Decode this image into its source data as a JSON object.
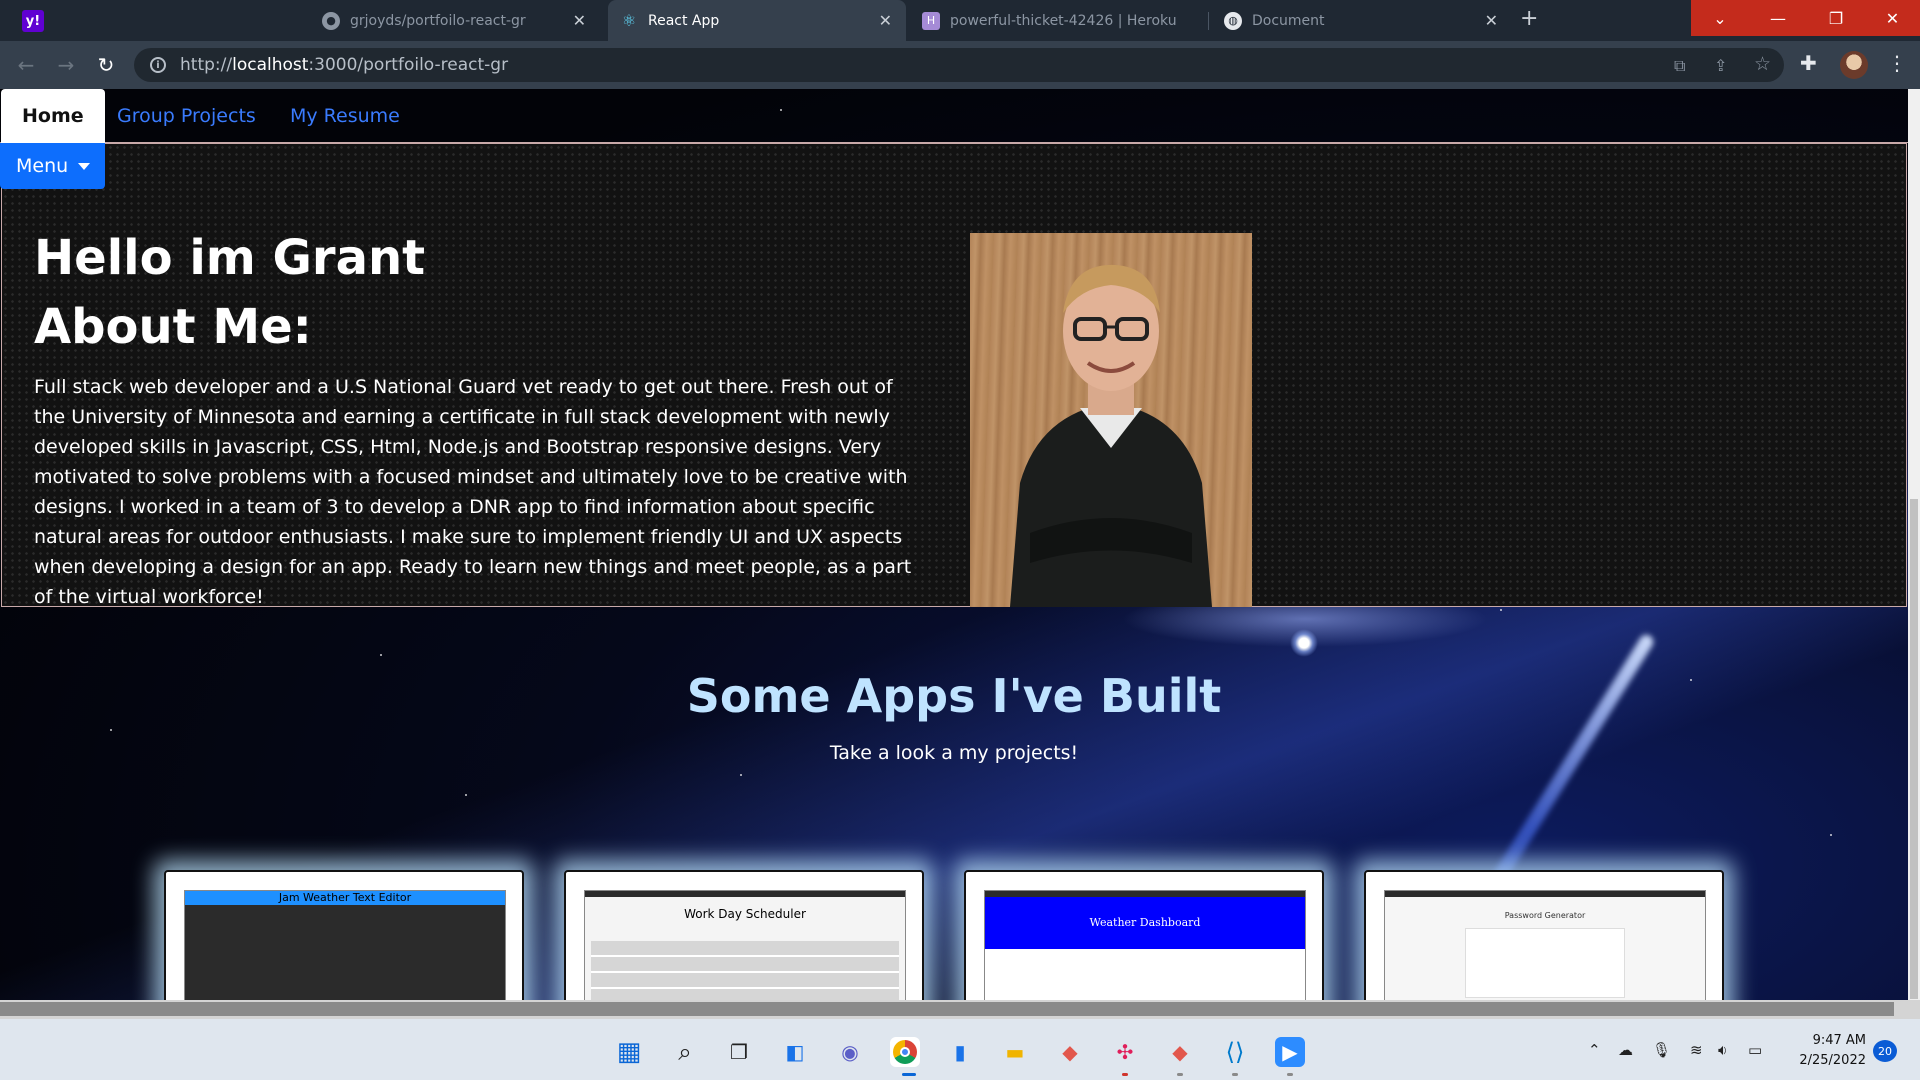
{
  "browser": {
    "tabs": [
      {
        "label": "grjoyds/portfoilo-react-gr",
        "icon": "github-icon",
        "active": false
      },
      {
        "label": "React App",
        "icon": "react-icon",
        "active": true
      },
      {
        "label": "powerful-thicket-42426 | Heroku",
        "icon": "heroku-icon",
        "active": false
      },
      {
        "label": "Document",
        "icon": "globe-icon",
        "active": false
      }
    ],
    "url_prefix": "http://",
    "url_host": "localhost",
    "url_rest": ":3000/portfoilo-react-gr"
  },
  "nav": {
    "tabs": [
      {
        "label": "Home",
        "active": true
      },
      {
        "label": "Group Projects",
        "active": false
      },
      {
        "label": "My Resume",
        "active": false
      }
    ],
    "menu_label": "Menu"
  },
  "about": {
    "hello": "Hello im Grant",
    "heading": "About Me:",
    "bio": "Full stack web developer and a U.S National Guard vet ready to get out there. Fresh out of the University of Minnesota and earning a certificate in full stack development with newly developed skills in Javascript, CSS, Html, Node.js and Bootstrap responsive designs. Very motivated to solve problems with a focused mindset and ultimately love to be creative with designs. I worked in a team of 3 to develop a DNR app to find information about specific natural areas for outdoor enthusiasts. I make sure to implement friendly UI and UX aspects when developing a design for an app. Ready to learn new things and meet people, as a part of the virtual workforce!"
  },
  "apps": {
    "title": "Some Apps I've Built",
    "subtitle": "Take a look a my projects!",
    "cards": [
      {
        "title": "Jam Weather Text Editor"
      },
      {
        "title": "Work Day Scheduler"
      },
      {
        "title": "Weather Dashboard"
      },
      {
        "title": "Password Generator"
      }
    ]
  },
  "taskbar": {
    "time": "9:47 AM",
    "date": "2/25/2022",
    "notifications": "20"
  },
  "colors": {
    "nav_link": "#3a7bfd",
    "menu_button": "#0d6efd",
    "apps_title": "#bfe3ff"
  }
}
